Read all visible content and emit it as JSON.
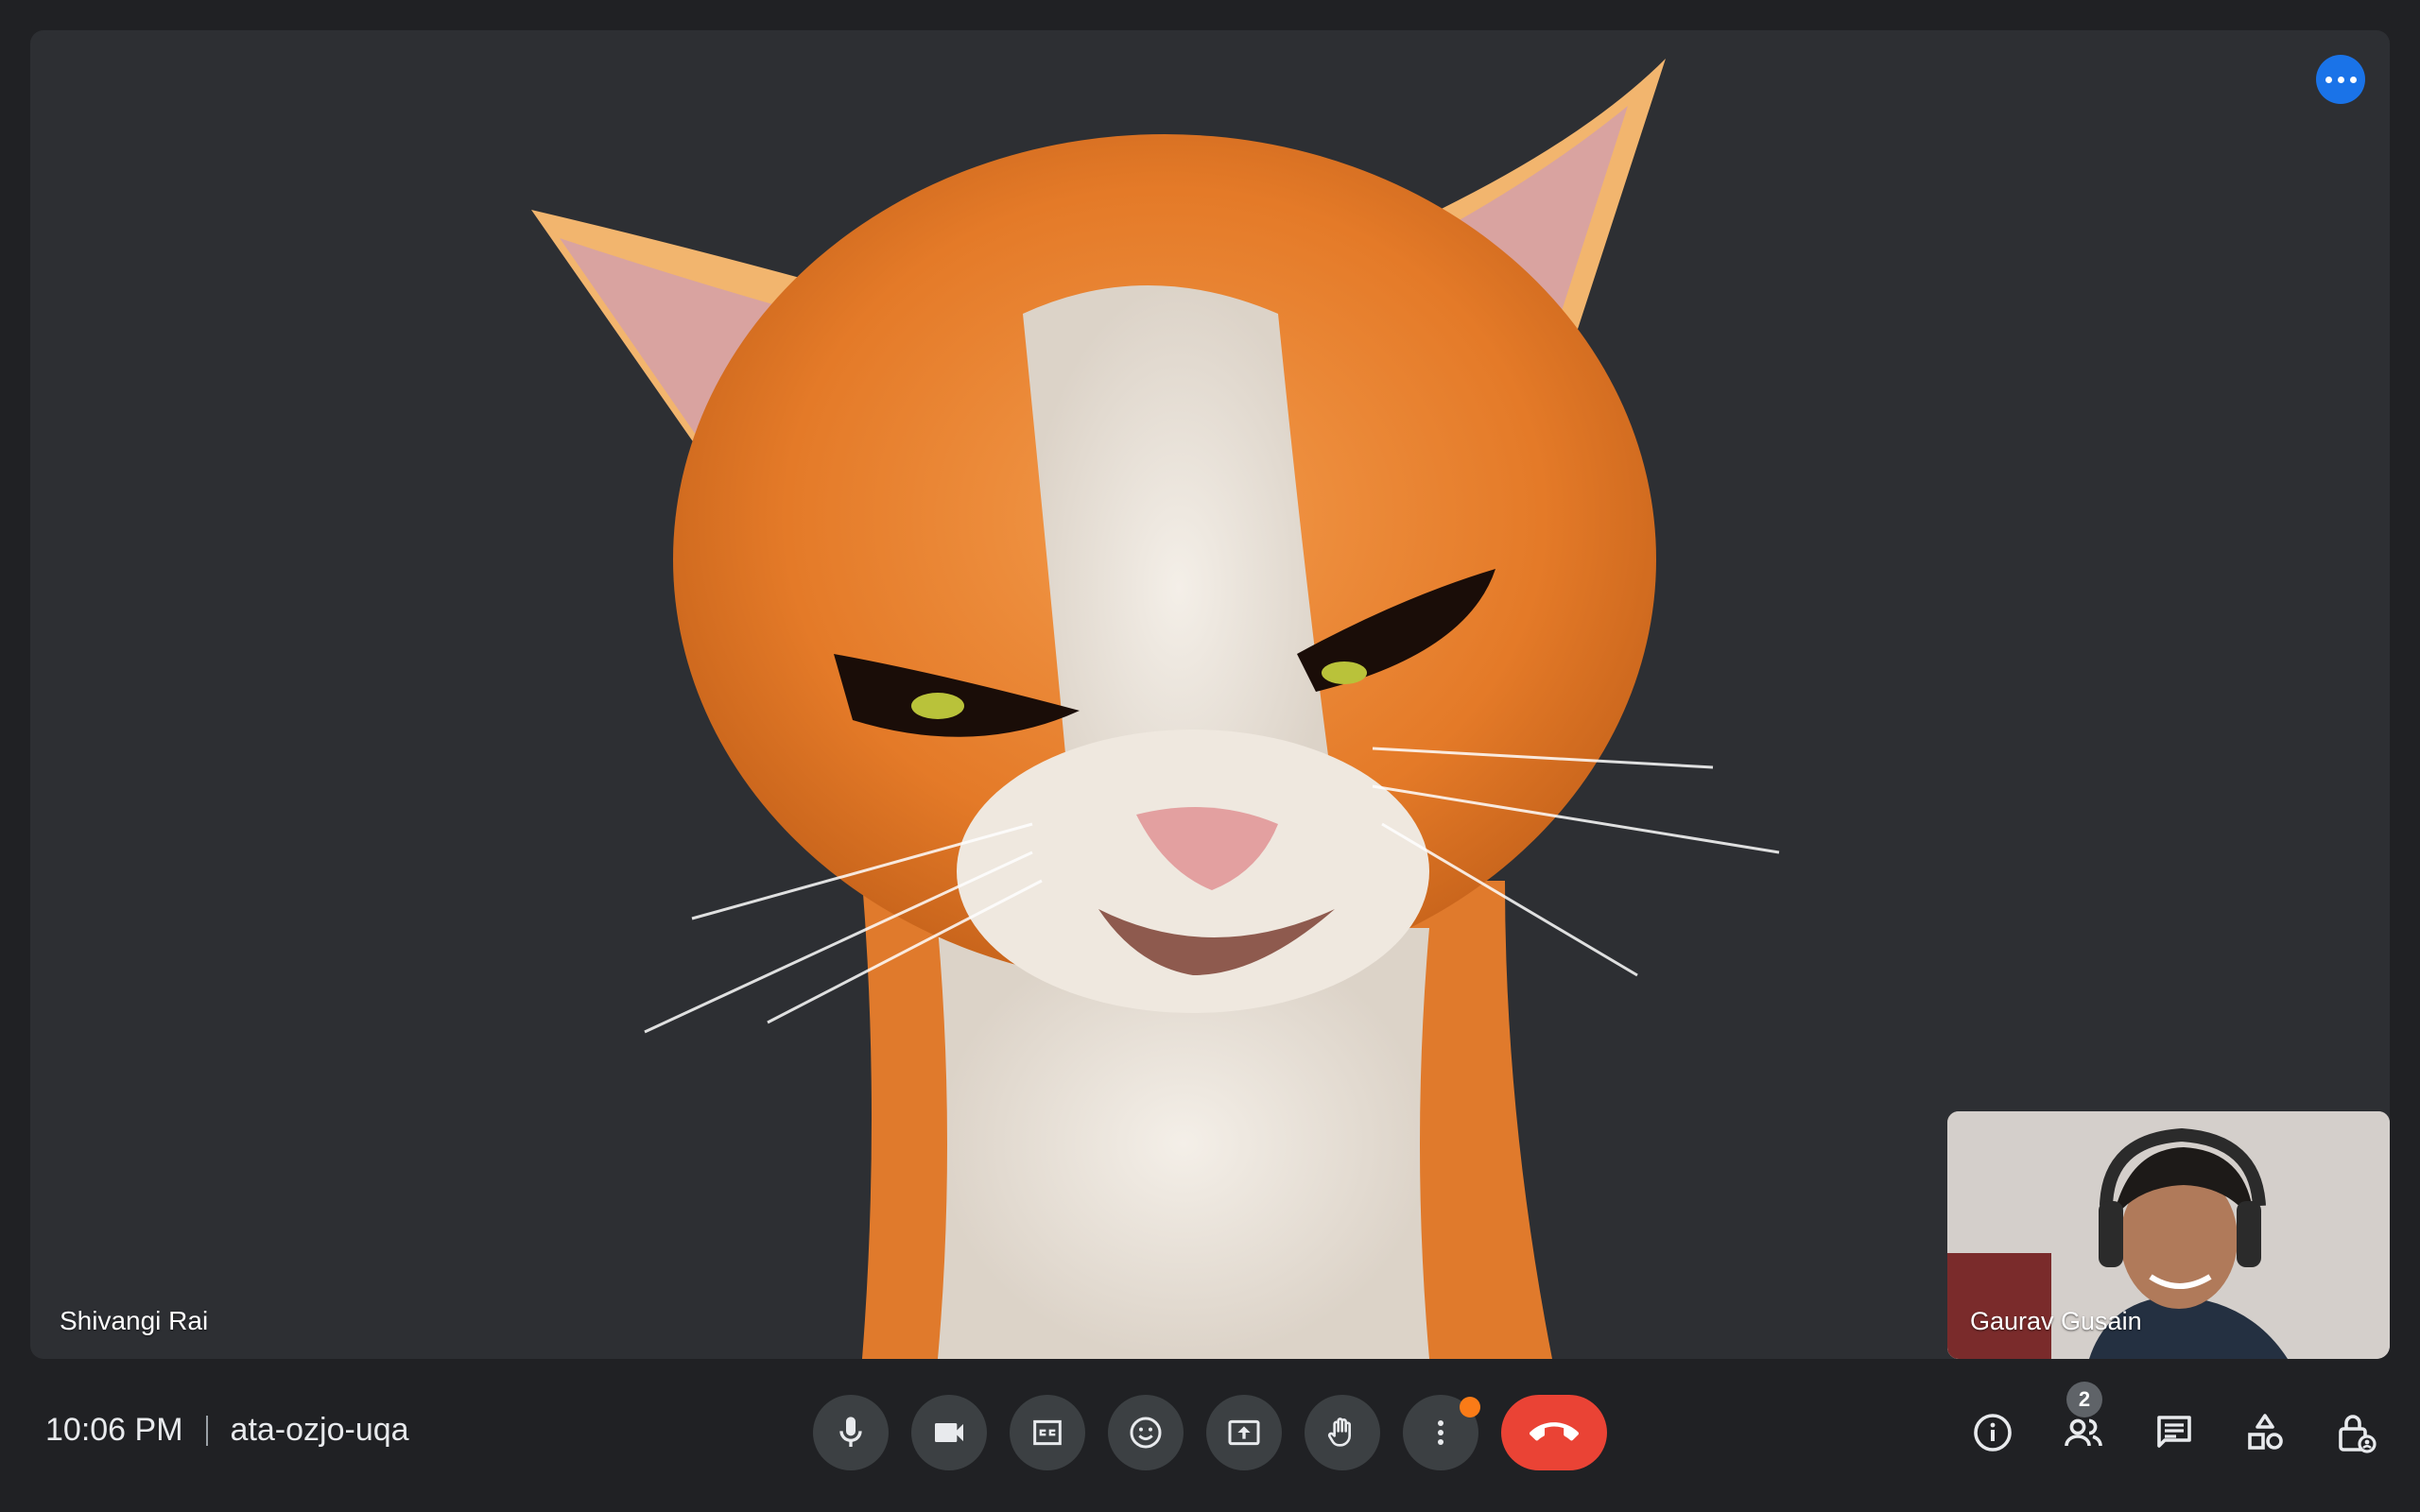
{
  "main_tile": {
    "participant_name": "Shivangi Rai",
    "menu_icon": "more-horiz-icon",
    "accent": "#1a73e8"
  },
  "self_view": {
    "participant_name": "Gaurav Gusain"
  },
  "meeting": {
    "time": "10:06 PM",
    "code": "ata-ozjo-uqa"
  },
  "controls": [
    {
      "name": "microphone",
      "icon": "mic-icon"
    },
    {
      "name": "camera",
      "icon": "videocam-icon"
    },
    {
      "name": "captions",
      "icon": "closed-caption-icon"
    },
    {
      "name": "reactions",
      "icon": "emoji-icon"
    },
    {
      "name": "present",
      "icon": "present-screen-icon"
    },
    {
      "name": "raise-hand",
      "icon": "hand-icon"
    },
    {
      "name": "more-options",
      "icon": "more-vert-icon",
      "has_notification": true
    },
    {
      "name": "leave-call",
      "icon": "call-end-icon",
      "color": "#ea4335"
    }
  ],
  "side_controls": {
    "participants_count": "2",
    "buttons": [
      "info-icon",
      "people-icon",
      "chat-icon",
      "activities-icon",
      "host-controls-icon"
    ]
  }
}
